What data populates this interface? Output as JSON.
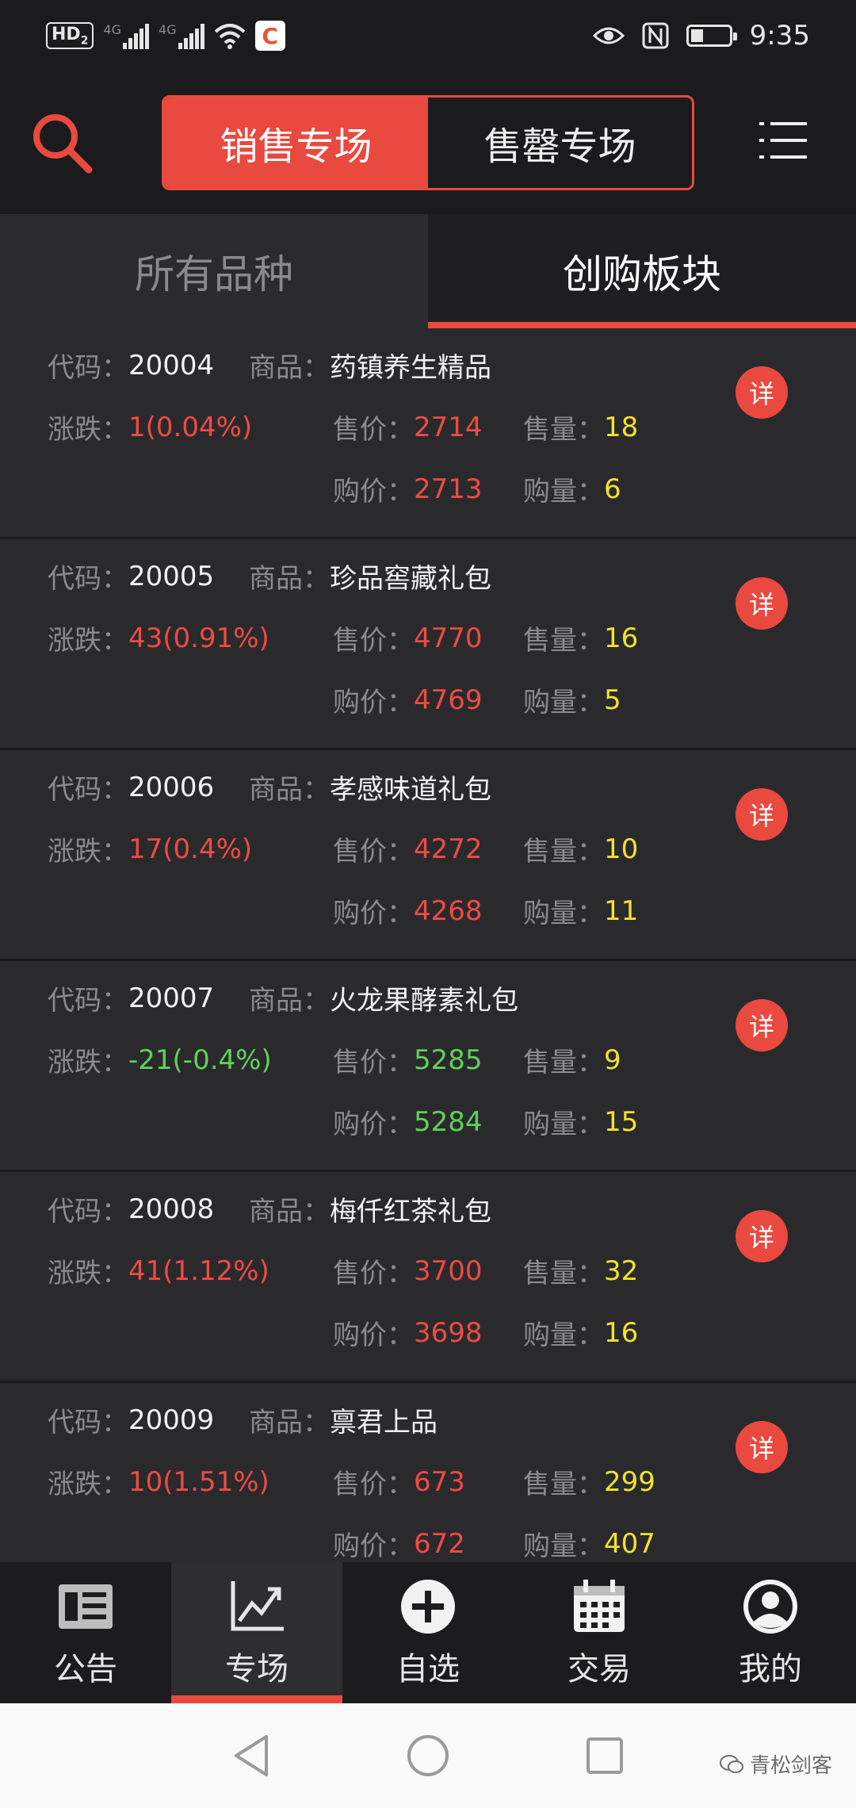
{
  "status": {
    "hd": "HD",
    "sim2": "2",
    "net1": "4G",
    "net2": "4G",
    "time": "9:35"
  },
  "header": {
    "segments": [
      "销售专场",
      "售罄专场"
    ],
    "active_segment": 0
  },
  "tabs": [
    {
      "label": "所有品种",
      "active": false
    },
    {
      "label": "创购板块",
      "active": true
    }
  ],
  "labels": {
    "code": "代码：",
    "product": "商品：",
    "change": "涨跌：",
    "sell_price": "售价：",
    "sell_qty": "售量：",
    "buy_price": "购价：",
    "buy_qty": "购量：",
    "detail": "详"
  },
  "items": [
    {
      "code": "20004",
      "name": "药镇养生精品",
      "change": "1(0.04%)",
      "trend": "up",
      "sell_price": "2714",
      "sell_qty": "18",
      "buy_price": "2713",
      "buy_qty": "6"
    },
    {
      "code": "20005",
      "name": "珍品窖藏礼包",
      "change": "43(0.91%)",
      "trend": "up",
      "sell_price": "4770",
      "sell_qty": "16",
      "buy_price": "4769",
      "buy_qty": "5"
    },
    {
      "code": "20006",
      "name": "孝感味道礼包",
      "change": "17(0.4%)",
      "trend": "up",
      "sell_price": "4272",
      "sell_qty": "10",
      "buy_price": "4268",
      "buy_qty": "11"
    },
    {
      "code": "20007",
      "name": "火龙果酵素礼包",
      "change": "-21(-0.4%)",
      "trend": "down",
      "sell_price": "5285",
      "sell_qty": "9",
      "buy_price": "5284",
      "buy_qty": "15"
    },
    {
      "code": "20008",
      "name": "梅仟红茶礼包",
      "change": "41(1.12%)",
      "trend": "up",
      "sell_price": "3700",
      "sell_qty": "32",
      "buy_price": "3698",
      "buy_qty": "16"
    },
    {
      "code": "20009",
      "name": "禀君上品",
      "change": "10(1.51%)",
      "trend": "up",
      "sell_price": "673",
      "sell_qty": "299",
      "buy_price": "672",
      "buy_qty": "407"
    }
  ],
  "bottom_nav": [
    {
      "label": "公告",
      "icon": "newspaper-icon",
      "active": false
    },
    {
      "label": "专场",
      "icon": "chart-trend-icon",
      "active": true
    },
    {
      "label": "自选",
      "icon": "plus-circle-icon",
      "active": false
    },
    {
      "label": "交易",
      "icon": "calendar-icon",
      "active": false
    },
    {
      "label": "我的",
      "icon": "user-icon",
      "active": false
    }
  ],
  "watermark": "青松剑客",
  "colors": {
    "accent": "#e9493f",
    "up": "#f04a43",
    "down": "#5fd15a",
    "qty": "#f2e22e"
  }
}
